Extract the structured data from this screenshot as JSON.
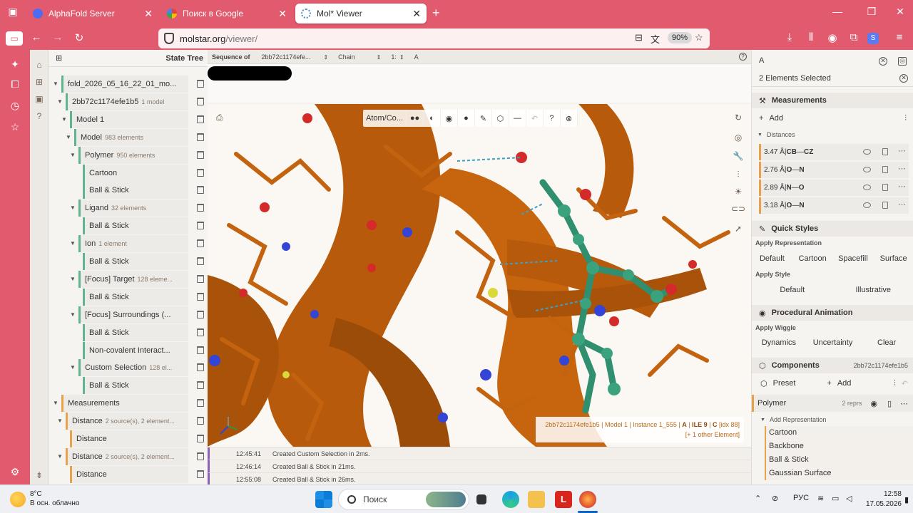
{
  "browser": {
    "tabs": [
      {
        "label": "AlphaFold Server",
        "color": "#4f6cf0"
      },
      {
        "label": "Поиск в Google",
        "color": "#ffffff"
      },
      {
        "label": "Mol* Viewer",
        "color": "#5b8fbf"
      }
    ],
    "url_host": "molstar.org",
    "url_path": "/viewer/",
    "zoom": "90%"
  },
  "seq": {
    "label": "Sequence of",
    "entity": "2bb72c1174efe...",
    "unit": "Chain",
    "model": "1:",
    "chain": "A"
  },
  "tree": {
    "title": "State Tree",
    "nodes": [
      {
        "label": "fold_2026_05_16_22_01_mo...",
        "sub": "",
        "indent": 0,
        "caret": true,
        "kind": "data"
      },
      {
        "label": "2bb72c1174efe1b5",
        "sub": "1 model",
        "indent": 1,
        "caret": true,
        "kind": "data"
      },
      {
        "label": "Model 1",
        "sub": "",
        "indent": 2,
        "caret": true,
        "kind": "data"
      },
      {
        "label": "Model",
        "sub": "983 elements",
        "indent": 3,
        "caret": true,
        "kind": "data"
      },
      {
        "label": "Polymer",
        "sub": "950 elements",
        "indent": 4,
        "caret": true,
        "kind": "data"
      },
      {
        "label": "Cartoon",
        "sub": "",
        "indent": 5,
        "caret": false,
        "kind": "repr"
      },
      {
        "label": "Ball & Stick",
        "sub": "",
        "indent": 5,
        "caret": false,
        "kind": "repr"
      },
      {
        "label": "Ligand",
        "sub": "32 elements",
        "indent": 4,
        "caret": true,
        "kind": "data"
      },
      {
        "label": "Ball & Stick",
        "sub": "",
        "indent": 5,
        "caret": false,
        "kind": "repr"
      },
      {
        "label": "Ion",
        "sub": "1 element",
        "indent": 4,
        "caret": true,
        "kind": "data"
      },
      {
        "label": "Ball & Stick",
        "sub": "",
        "indent": 5,
        "caret": false,
        "kind": "repr"
      },
      {
        "label": "[Focus] Target",
        "sub": "128 eleme...",
        "indent": 4,
        "caret": true,
        "kind": "data"
      },
      {
        "label": "Ball & Stick",
        "sub": "",
        "indent": 5,
        "caret": false,
        "kind": "repr"
      },
      {
        "label": "[Focus] Surroundings (...",
        "sub": "",
        "indent": 4,
        "caret": true,
        "kind": "data"
      },
      {
        "label": "Ball & Stick",
        "sub": "",
        "indent": 5,
        "caret": false,
        "kind": "repr"
      },
      {
        "label": "Non-covalent Interact...",
        "sub": "",
        "indent": 5,
        "caret": false,
        "kind": "repr"
      },
      {
        "label": "Custom Selection",
        "sub": "128 el...",
        "indent": 4,
        "caret": true,
        "kind": "data"
      },
      {
        "label": "Ball & Stick",
        "sub": "",
        "indent": 5,
        "caret": false,
        "kind": "repr"
      },
      {
        "label": "Measurements",
        "sub": "",
        "indent": 0,
        "caret": true,
        "kind": "meas"
      },
      {
        "label": "Distance",
        "sub": "2 source(s), 2 element...",
        "indent": 1,
        "caret": true,
        "kind": "meas"
      },
      {
        "label": "Distance",
        "sub": "",
        "indent": 2,
        "caret": false,
        "kind": "meas"
      },
      {
        "label": "Distance",
        "sub": "2 source(s), 2 element...",
        "indent": 1,
        "caret": true,
        "kind": "meas"
      },
      {
        "label": "Distance",
        "sub": "",
        "indent": 2,
        "caret": false,
        "kind": "meas"
      }
    ]
  },
  "viewer": {
    "toolbar": {
      "mode": "Atom/Co..."
    },
    "hover": {
      "entry": "2bb72c1174efe1b5",
      "model": "Model 1",
      "instance": "Instance 1_555",
      "chain": "A",
      "residue": "ILE 9",
      "atom": "C",
      "idx": "[idx 88]",
      "extra": "[+ 1 other Element]"
    }
  },
  "log": [
    {
      "time": "12:45:41",
      "msg": "Created Custom Selection in 2ms."
    },
    {
      "time": "12:46:14",
      "msg": "Created Ball & Stick in 21ms."
    },
    {
      "time": "12:55:08",
      "msg": "Created Ball & Stick in 26ms."
    }
  ],
  "right": {
    "search_value": "A",
    "selected": "2 Elements Selected",
    "measurements": {
      "title": "Measurements",
      "add": "Add",
      "distances_label": "Distances",
      "items": [
        {
          "dist": "3.47 Å",
          "a": "CB",
          "b": "CZ"
        },
        {
          "dist": "2.76 Å",
          "a": "O",
          "b": "N"
        },
        {
          "dist": "2.89 Å",
          "a": "N",
          "b": "O"
        },
        {
          "dist": "3.18 Å",
          "a": "O",
          "b": "N"
        }
      ]
    },
    "quick": {
      "title": "Quick Styles",
      "apply_repr": "Apply Representation",
      "repr_buttons": [
        "Default",
        "Cartoon",
        "Spacefill",
        "Surface"
      ],
      "apply_style": "Apply Style",
      "style_buttons": [
        "Default",
        "Illustrative"
      ]
    },
    "anim": {
      "title": "Procedural Animation",
      "apply_wiggle": "Apply Wiggle",
      "buttons": [
        "Dynamics",
        "Uncertainty",
        "Clear"
      ]
    },
    "components": {
      "title": "Components",
      "entry": "2bb72c1174efe1b5",
      "preset": "Preset",
      "add": "Add",
      "polymer": "Polymer",
      "reprs": "2 reprs",
      "add_repr": "Add Representation",
      "repr_list": [
        "Cartoon",
        "Backbone",
        "Ball & Stick",
        "Gaussian Surface"
      ]
    }
  },
  "taskbar": {
    "temp": "8°C",
    "weather": "В осн. облачно",
    "search": "Поиск",
    "lang": "РУС",
    "time": "12:58",
    "date": "17.05.2026"
  }
}
